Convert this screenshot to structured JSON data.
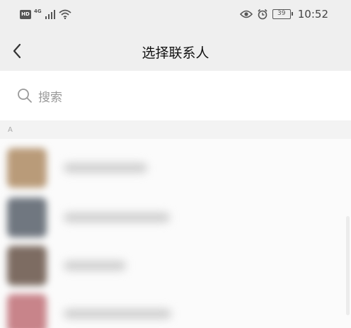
{
  "status_bar": {
    "hd": "HD",
    "network": "4G",
    "battery": "39",
    "time": "10:52",
    "icons": [
      "signal-icon",
      "wifi-icon",
      "eye-icon",
      "alarm-icon"
    ]
  },
  "header": {
    "title": "选择联系人",
    "back_icon": "chevron-left-icon"
  },
  "search": {
    "placeholder": "搜索",
    "icon": "search-icon"
  },
  "section": {
    "letter": "A"
  },
  "contacts": {
    "avatar_colors": [
      "#b99b79",
      "#707780",
      "#7d6c62",
      "#c8848a"
    ]
  }
}
